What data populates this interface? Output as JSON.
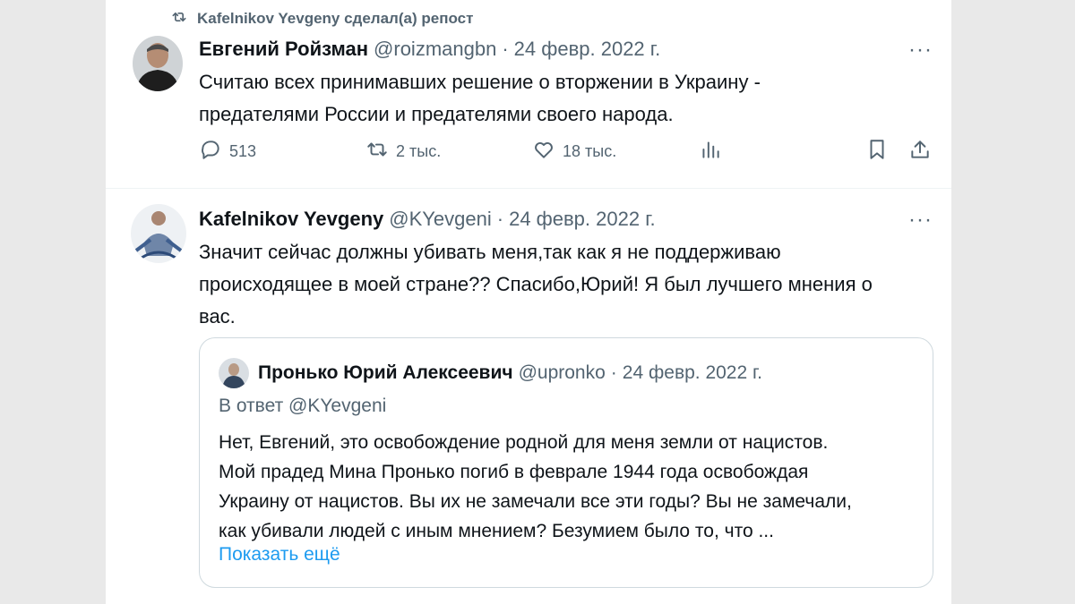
{
  "repost": {
    "label": "Kafelnikov Yevgeny сделал(а) репост",
    "icon": "repost-icon"
  },
  "tweet1": {
    "name": "Евгений Ройзман",
    "handle": "@roizmangbn",
    "separator": "·",
    "date": "24 февр. 2022 г.",
    "more": "···",
    "text_lines": [
      "Считаю всех принимавших решение о вторжении в Украину -",
      "предателями России и предателями  своего народа."
    ],
    "actions": {
      "replies": "513",
      "reposts": "2 тыс.",
      "likes": "18 тыс."
    }
  },
  "tweet2": {
    "name": "Kafelnikov Yevgeny",
    "handle": "@KYevgeni",
    "separator": "·",
    "date": "24 февр. 2022 г.",
    "more": "···",
    "text_lines": [
      "Значит сейчас должны убивать меня,так как я не поддерживаю",
      "происходящее в моей стране?? Спасибо,Юрий! Я был лучшего мнения о",
      "вас."
    ]
  },
  "quote": {
    "name": "Пронько Юрий Алексеевич",
    "handle": "@upronko",
    "separator": "·",
    "date": "24 февр. 2022 г.",
    "reply_to": "В ответ @KYevgeni",
    "text_lines": [
      "Нет, Евгений, это освобождение родной для меня земли от нацистов.",
      "Мой прадед Мина Пронько погиб в феврале 1944 года освобождая",
      "Украину от нацистов. Вы их не замечали все эти годы? Вы не замечали,",
      "как убивали людей с иным мнением? Безумием было то, что ..."
    ],
    "show_more": "Показать ещё"
  },
  "colors": {
    "text": "#0f1419",
    "muted": "#536471",
    "link": "#1d9bf0",
    "border": "#cfd9de"
  }
}
